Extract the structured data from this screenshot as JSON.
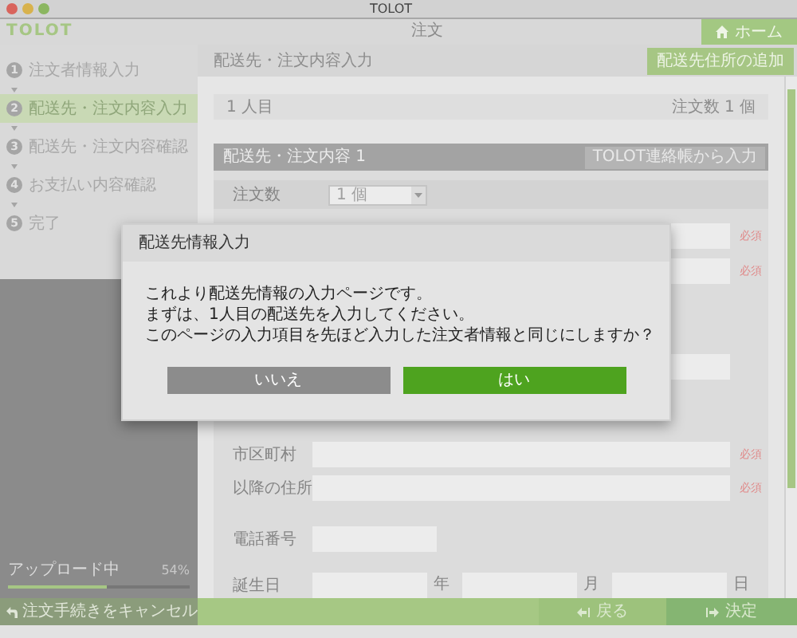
{
  "window": {
    "title": "TOLOT"
  },
  "header": {
    "logo": "TOLOT",
    "title": "注文",
    "home_button": "ホーム"
  },
  "steps": [
    {
      "number": "1",
      "label": "注文者情報入力",
      "selected": false
    },
    {
      "number": "2",
      "label": "配送先・注文内容入力",
      "selected": true
    },
    {
      "number": "3",
      "label": "配送先・注文内容確認",
      "selected": false
    },
    {
      "number": "4",
      "label": "お支払い内容確認",
      "selected": false
    },
    {
      "number": "5",
      "label": "完了",
      "selected": false
    }
  ],
  "upload": {
    "label": "アップロード中",
    "percent": "54%",
    "level": 0.54
  },
  "cancel_button": "注文手続きをキャンセル",
  "breadcrumb": "配送先・注文内容入力",
  "add_address_button": "配送先住所の追加",
  "recipient": {
    "label": "1 人目",
    "count": "注文数 1 個"
  },
  "section": {
    "title": "配送先・注文内容 1",
    "address_book_button": "TOLOT連絡帳から入力"
  },
  "form_rows": [
    {
      "kind": "select",
      "label": "注文数",
      "value": "1 個"
    },
    {
      "kind": "text",
      "required_mark": "必須"
    },
    {
      "kind": "text",
      "required_mark": "必須"
    },
    {
      "kind": "text"
    },
    {
      "kind": "text",
      "label": "市区町村",
      "required_mark": "必須"
    },
    {
      "kind": "text",
      "label": "以降の住所",
      "required_mark": "必須"
    },
    {
      "kind": "short",
      "label": "電話番号"
    },
    {
      "kind": "date",
      "label": "誕生日",
      "units": [
        "年",
        "月",
        "日"
      ]
    }
  ],
  "dialog": {
    "title": "配送先情報入力",
    "lines": [
      "これより配送先情報の入力ページです。",
      "まずは、1人目の配送先を入力してください。",
      "このページの入力項目を先ほど入力した注文者情報と同じにしますか？"
    ],
    "buttons": [
      {
        "label": "いいえ",
        "primary": false
      },
      {
        "label": "はい",
        "primary": true
      }
    ]
  },
  "footer": {
    "back_button": "戻る",
    "confirm_button": "決定"
  }
}
